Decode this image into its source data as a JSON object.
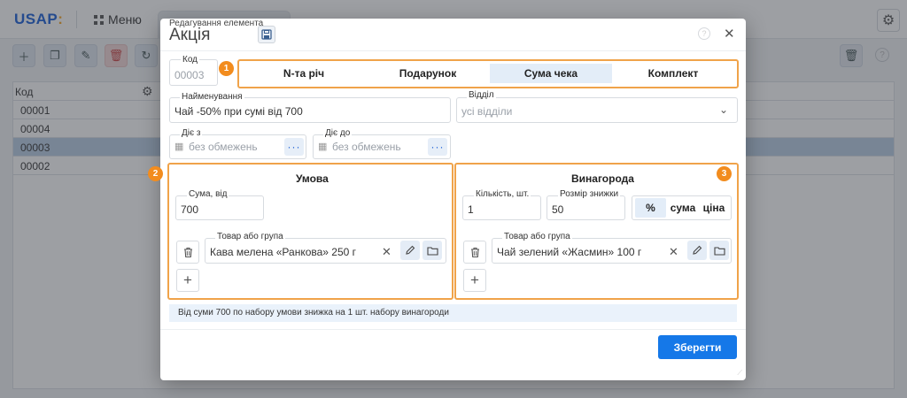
{
  "app": {
    "logo_main": "USAP",
    "logo_mark": ":",
    "menu_label": "Меню",
    "table_header": "Код",
    "rows": [
      "00001",
      "00004",
      "00003",
      "00002"
    ],
    "selected_row_index": 2
  },
  "dialog": {
    "subtitle": "Редагування елемента",
    "title": "Акція",
    "code": {
      "label": "Код",
      "value": "00003"
    },
    "tabs": {
      "items": [
        "N-та річ",
        "Подарунок",
        "Сума чека",
        "Комплект"
      ],
      "active_index": 2
    },
    "badges": [
      "1",
      "2",
      "3"
    ],
    "name": {
      "label": "Найменування",
      "value": "Чай -50% при сумі від 700"
    },
    "department": {
      "label": "Відділ",
      "placeholder": "усі відділи"
    },
    "date_from": {
      "label": "Діє з",
      "placeholder": "без обмежень"
    },
    "date_to": {
      "label": "Діє до",
      "placeholder": "без обмежень"
    },
    "condition": {
      "title": "Умова",
      "sum_label": "Сума, від",
      "sum_value": "700",
      "product_label": "Товар або група",
      "product_value": "Кава мелена «Ранкова» 250 г"
    },
    "reward": {
      "title": "Винагорода",
      "qty_label": "Кількість, шт.",
      "qty_value": "1",
      "discount_label": "Розмір знижки",
      "discount_value": "50",
      "discount_modes": [
        "%",
        "сума",
        "ціна"
      ],
      "discount_mode_active": 0,
      "product_label": "Товар або група",
      "product_value": "Чай зелений «Жасмин» 100 г"
    },
    "info_text": "Від суми 700 по набору умови знижка на 1 шт. набору винагороди",
    "save_label": "Зберегти"
  },
  "colors": {
    "accent": "#1578e8",
    "highlight": "#f0a34a",
    "badge": "#f28c1e",
    "selected_row": "#b8cde4"
  }
}
